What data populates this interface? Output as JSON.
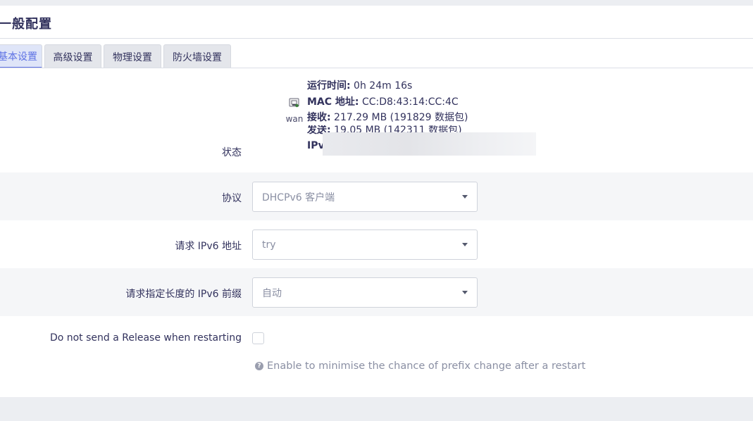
{
  "section": {
    "title": "一般配置"
  },
  "tabs": [
    {
      "label": "基本设置",
      "active": true
    },
    {
      "label": "高级设置",
      "active": false
    },
    {
      "label": "物理设置",
      "active": false
    },
    {
      "label": "防火墙设置",
      "active": false
    }
  ],
  "status": {
    "label": "状态",
    "interface_name": "wan",
    "interface_icon": "ethernet-port-icon",
    "uptime_key": "运行时间:",
    "uptime_val": " 0h 24m 16s",
    "mac_key": "MAC 地址:",
    "mac_val": " CC:D8:43:14:CC:4C",
    "rx_key": "接收:",
    "rx_val": " 217.29 MB (191829 数据包)",
    "tx_key": "发送:",
    "tx_val": " 19.05 MB (142311 数据包)",
    "ipv_key": "IPv"
  },
  "fields": {
    "protocol": {
      "label": "协议",
      "value": "DHCPv6 客户端"
    },
    "request_address": {
      "label": "请求 IPv6 地址",
      "value": "try"
    },
    "prefix_length": {
      "label": "请求指定长度的 IPv6 前缀",
      "value": "自动"
    },
    "no_release": {
      "label": "Do not send a Release when restarting",
      "checked": false,
      "help": "Enable to minimise the chance of prefix change after a restart"
    }
  },
  "colors": {
    "accent": "#5e72e4",
    "text": "#32325d",
    "muted": "#8a8fa3"
  }
}
